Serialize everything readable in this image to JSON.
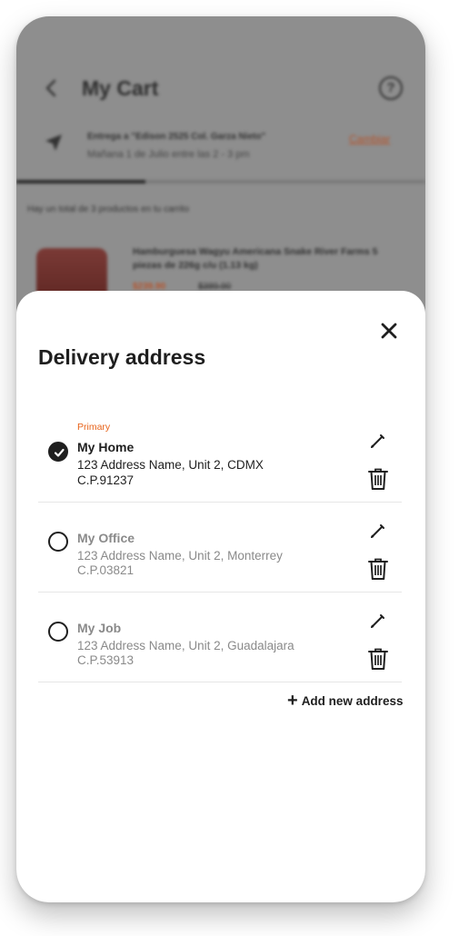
{
  "background": {
    "cart_title": "My Cart",
    "help_icon": "help-circle-icon",
    "delivery_to": "Entrega a \"Edison 2525 Col. Garza Nieto\"",
    "delivery_when": "Mañana 1 de Julio entre las 2 - 3 pm",
    "change_label": "Cambiar",
    "total_text": "Hay un total de 3 productos en tu carrito",
    "product_name": "Hamburguesa Wagyu Americana Snake River Farms 5 piezas de 226g c/u (1.13 kg)",
    "price_now": "$239.90",
    "price_old": "$389.90"
  },
  "sheet": {
    "title": "Delivery address",
    "close_icon": "close-icon",
    "addresses": [
      {
        "tag": "Primary",
        "name": "My Home",
        "line": "123 Address Name, Unit 2, CDMX",
        "cp": "C.P.91237",
        "selected": true
      },
      {
        "tag": "",
        "name": "My Office",
        "line": "123 Address Name, Unit 2, Monterrey",
        "cp": "C.P.03821",
        "selected": false
      },
      {
        "tag": "",
        "name": "My Job",
        "line": "123 Address Name, Unit 2, Guadalajara",
        "cp": "C.P.53913",
        "selected": false
      }
    ],
    "add_label": "Add new address"
  },
  "colors": {
    "accent": "#e8641b",
    "text": "#1f1f1f",
    "muted": "#8a8a8a",
    "overlay": "#8e8e8e"
  }
}
